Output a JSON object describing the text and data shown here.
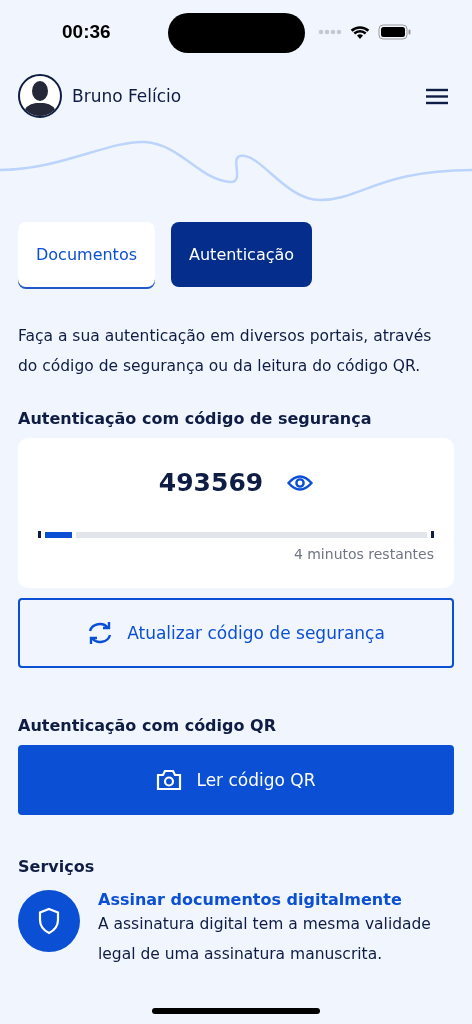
{
  "status_bar": {
    "time": "00:36"
  },
  "header": {
    "user_name": "Bruno Felício"
  },
  "tabs": [
    {
      "label": "Documentos",
      "selected": false
    },
    {
      "label": "Autenticação",
      "selected": true
    }
  ],
  "intro": "Faça a sua autenticação em diversos portais, através do código de segurança ou da leitura do código QR.",
  "security_code": {
    "heading": "Autenticação com código de segurança",
    "code": "493569",
    "level": 0.08,
    "remaining": "4 minutos restantes",
    "refresh_button": "Atualizar código de segurança"
  },
  "qr": {
    "heading": "Autenticação com código QR",
    "button": "Ler código QR"
  },
  "services": {
    "heading": "Serviços",
    "items": [
      {
        "title": "Assinar documentos digitalmente",
        "description": "A assinatura digital tem a mesma validade legal de uma assinatura manuscrita."
      }
    ]
  }
}
